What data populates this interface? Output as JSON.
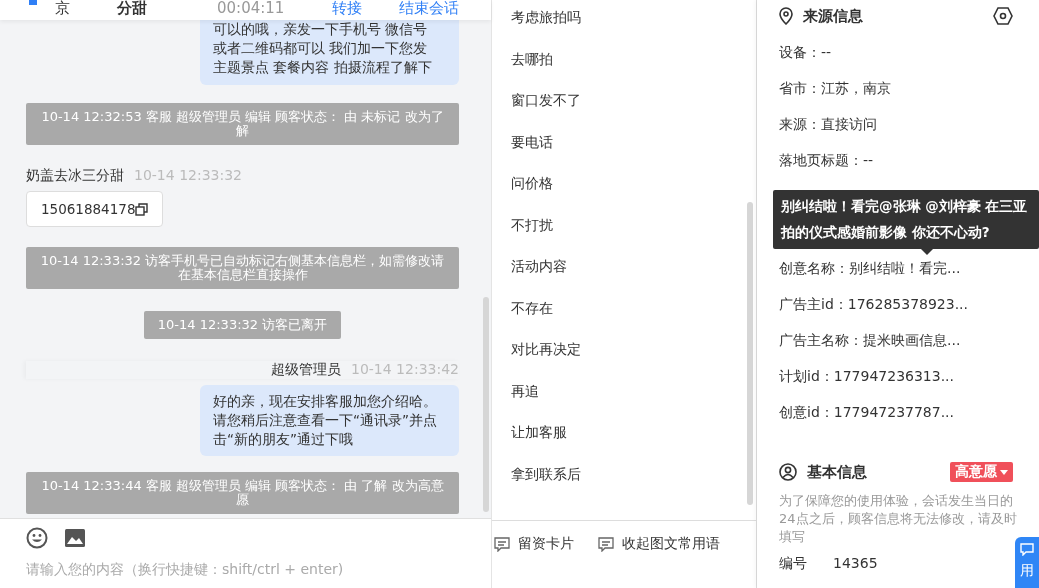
{
  "top_bar": {
    "visitor": "京",
    "name": "分甜",
    "duration": "00:04:11",
    "actions": [
      "转接",
      "结束会话"
    ]
  },
  "messages": [
    {
      "kind": "bubble",
      "text": "可以的哦，亲发一下手机号 微信号或者二维码都可以 我们加一下您发主题景点 套餐内容 拍摄流程了解下"
    },
    {
      "kind": "system",
      "text": "10-14 12:32:53 客服 超级管理员 编辑 顾客状态： 由 未标记 改为了解"
    },
    {
      "kind": "visitor",
      "name": "奶盖去冰三分甜",
      "time": "10-14 12:33:32",
      "content": "15061884178"
    },
    {
      "kind": "system",
      "text": "10-14 12:33:32 访客手机号已自动标记右侧基本信息栏，如需修改请在基本信息栏直接操作"
    },
    {
      "kind": "pill",
      "text": "10-14 12:33:32 访客已离开"
    },
    {
      "kind": "agent",
      "name": "超级管理员",
      "time": "10-14 12:33:42",
      "text": "好的亲，现在安排客服加您介绍哈。请您稍后注意查看一下“通讯录”并点击“新的朋友”通过下哦"
    },
    {
      "kind": "system",
      "text": "10-14 12:33:44 客服 超级管理员 编辑 顾客状态： 由 了解 改为高意愿"
    }
  ],
  "input": {
    "placeholder": "请输入您的内容（换行快捷键：shift/ctrl + enter)"
  },
  "phrases": [
    "考虑旅拍吗",
    "去哪拍",
    "窗口发不了",
    "要电话",
    "问价格",
    "不打扰",
    "活动内容",
    "不存在",
    "对比再决定",
    "再追",
    "让加客服",
    "拿到联系后"
  ],
  "phrase_tools": [
    "留资卡片",
    "收起图文常用语"
  ],
  "source": {
    "title": "来源信息",
    "rows": [
      "设备：--",
      "省市：江苏，南京",
      "来源：直接访问",
      "落地页标题：--"
    ],
    "rows_after": [
      "创意名称：别纠结啦！看完...",
      "广告主id：176285378923...",
      "广告主名称：提米映画信息...",
      "计划id：177947236313...",
      "创意id：177947237787..."
    ],
    "tooltip": "别纠结啦！看完@张琳 @刘梓豪 在三亚拍的仪式感婚前影像 你还不心动?"
  },
  "basic": {
    "title": "基本信息",
    "status": "高意愿",
    "note": "为了保障您的使用体验，会话发生当日的24点之后，顾客信息将无法修改，请及时填写",
    "fields": [
      {
        "label": "编号",
        "value": "14365"
      }
    ]
  },
  "float_button": {
    "label": "用"
  }
}
